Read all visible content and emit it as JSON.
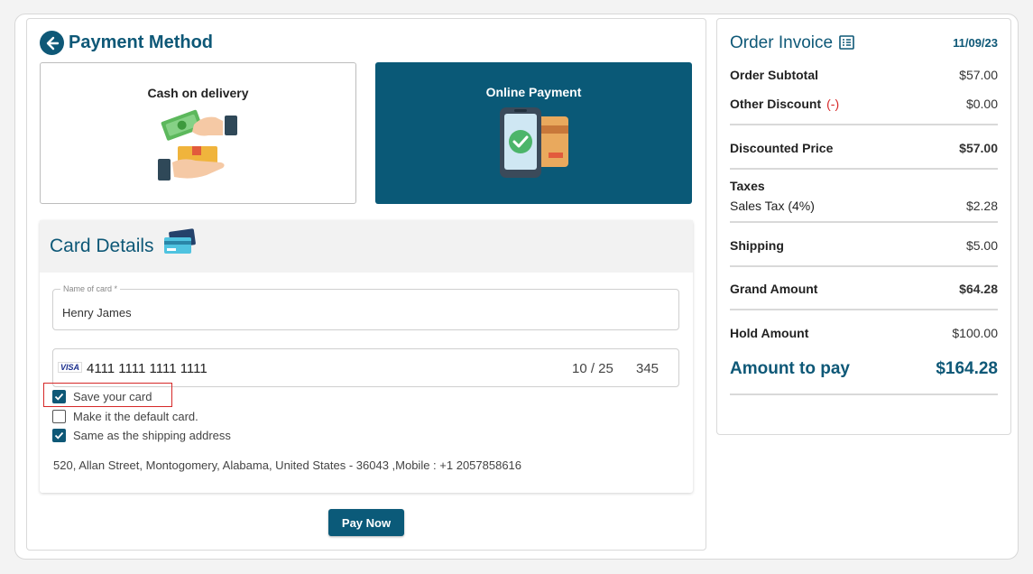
{
  "payment": {
    "title": "Payment Method",
    "options": [
      {
        "label": "Cash on delivery",
        "selected": false
      },
      {
        "label": "Online Payment",
        "selected": true
      }
    ]
  },
  "card_details": {
    "title": "Card Details",
    "name_label": "Name of card *",
    "name_value": "Henry James",
    "card_brand": "VISA",
    "card_number": "4111 1111 1111 1111",
    "expiry": "10 / 25",
    "cvc": "345",
    "save_card_label": "Save your card",
    "save_card_checked": true,
    "default_card_label": "Make it the default card.",
    "default_card_checked": false,
    "same_shipping_label": "Same as the shipping address",
    "same_shipping_checked": true,
    "address": "520, Allan Street, Montogomery, Alabama, United States - 36043 ,Mobile : +1 2057858616",
    "pay_button": "Pay Now"
  },
  "invoice": {
    "title": "Order Invoice",
    "date": "11/09/23",
    "order_subtotal_label": "Order Subtotal",
    "order_subtotal": "$57.00",
    "other_discount_label": "Other Discount",
    "other_discount_sign": "(-)",
    "other_discount": "$0.00",
    "discounted_price_label": "Discounted Price",
    "discounted_price": "$57.00",
    "taxes_label": "Taxes",
    "sales_tax_label": "Sales Tax (4%)",
    "sales_tax": "$2.28",
    "shipping_label": "Shipping",
    "shipping": "$5.00",
    "grand_amount_label": "Grand Amount",
    "grand_amount": "$64.28",
    "hold_amount_label": "Hold Amount",
    "hold_amount": "$100.00",
    "amount_to_pay_label": "Amount to pay",
    "amount_to_pay": "$164.28"
  },
  "colors": {
    "brand": "#0e5877",
    "highlight": "#d62828"
  }
}
